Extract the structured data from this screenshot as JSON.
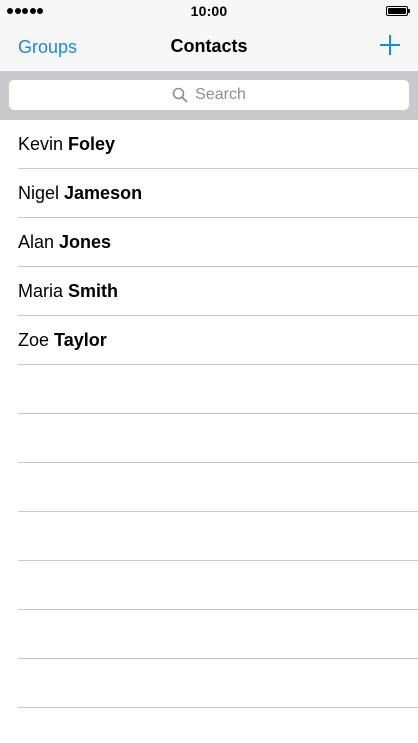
{
  "status_bar": {
    "time": "10:00",
    "signal_bars": 5,
    "battery_icon": "battery-full-icon"
  },
  "nav": {
    "left_button": "Groups",
    "title": "Contacts",
    "add_icon": "plus-icon",
    "accent_color": "#1a8be0"
  },
  "search": {
    "placeholder": "Search",
    "icon": "magnifier-icon",
    "band_color": "#c9c9ce"
  },
  "contacts": [
    {
      "first": "Kevin",
      "last": "Foley"
    },
    {
      "first": "Nigel",
      "last": "Jameson"
    },
    {
      "first": "Alan",
      "last": "Jones"
    },
    {
      "first": "Maria",
      "last": "Smith"
    },
    {
      "first": "Zoe",
      "last": "Taylor"
    }
  ]
}
